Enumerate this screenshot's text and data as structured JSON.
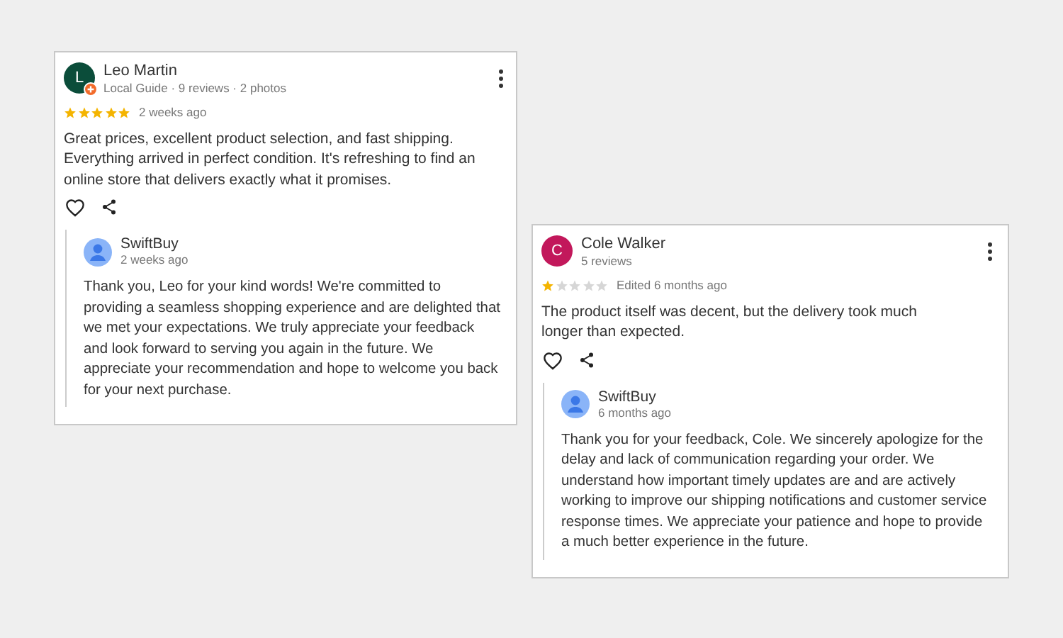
{
  "reviews": [
    {
      "initial": "L",
      "color": "#0b4d3a",
      "guide_badge": true,
      "name": "Leo Martin",
      "meta": "Local Guide · 9 reviews · 2 photos",
      "stars": 5,
      "time": "2 weeks ago",
      "text": "Great prices, excellent product selection, and fast shipping. Everything arrived in perfect condition. It's refreshing to find an online store that delivers exactly what it promises.",
      "reply": {
        "name": "SwiftBuy",
        "time": "2 weeks ago",
        "text": "Thank you, Leo for your kind words! We're committed to providing a seamless shopping experience and are delighted that we met your expectations. We truly appreciate your feedback and look forward to serving you again in the future. We appreciate your recommendation and hope to welcome you back for your next purchase."
      }
    },
    {
      "initial": "C",
      "color": "#c2185b",
      "guide_badge": false,
      "name": "Cole Walker",
      "meta": "5 reviews",
      "stars": 1,
      "time": "Edited 6 months ago",
      "text": "The product itself was decent, but the delivery took much longer than expected.",
      "reply": {
        "name": "SwiftBuy",
        "time": "6 months ago",
        "text": "Thank you for your feedback, Cole. We sincerely apologize for the delay and lack of communication regarding your order. We understand how important timely updates are and are actively working to improve our shipping notifications and customer service response times. We appreciate your patience and hope to provide a much better experience in the future."
      }
    }
  ]
}
